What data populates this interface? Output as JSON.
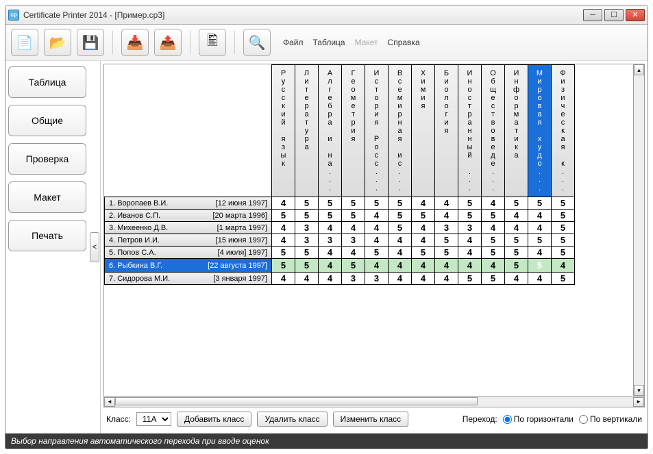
{
  "window": {
    "title": "Certificate Printer 2014 - [Пример.cp3]"
  },
  "toolbar_icons": {
    "new": "📄",
    "open": "📂",
    "save": "💾",
    "import": "📥",
    "export": "📤",
    "preview": "🖺",
    "search": "🔍"
  },
  "menu": {
    "file": "Файл",
    "table": "Таблица",
    "layout": "Макет",
    "help": "Справка"
  },
  "sidebar": {
    "items": [
      "Таблица",
      "Общие",
      "Проверка",
      "Макет",
      "Печать"
    ],
    "toggle": "<"
  },
  "columns": [
    "Русский язык",
    "Литература",
    "Алгебра и на...",
    "Геометрия",
    "История Росс...",
    "Всемирная ис...",
    "Химия",
    "Биология",
    "Иностранный ...",
    "Обществоведе...",
    "Информатика",
    "Мировая худо...",
    "Физическая к..."
  ],
  "highlight_col": 11,
  "rows": [
    {
      "n": "1. Воропаев В.И.",
      "d": "[12 июня 1997]",
      "v": [
        4,
        5,
        5,
        5,
        5,
        5,
        4,
        4,
        5,
        4,
        5,
        5,
        5
      ]
    },
    {
      "n": "2. Иванов С.П.",
      "d": "[20 марта 1996]",
      "v": [
        5,
        5,
        5,
        5,
        4,
        5,
        5,
        4,
        5,
        5,
        4,
        4,
        5
      ]
    },
    {
      "n": "3. Михеенко Д.В.",
      "d": "[1 марта 1997]",
      "v": [
        4,
        3,
        4,
        4,
        4,
        5,
        4,
        3,
        3,
        4,
        4,
        4,
        5
      ]
    },
    {
      "n": "4. Петров И.И.",
      "d": "[15 июня 1997]",
      "v": [
        4,
        3,
        3,
        3,
        4,
        4,
        4,
        5,
        4,
        5,
        5,
        5,
        5
      ]
    },
    {
      "n": "5. Попов С.А.",
      "d": "[4 июля] 1997]",
      "v": [
        5,
        5,
        4,
        4,
        5,
        4,
        5,
        5,
        4,
        5,
        5,
        4,
        5
      ]
    },
    {
      "n": "6. Рыбкина В.Г.",
      "d": "[22 августа 1997]",
      "v": [
        5,
        5,
        4,
        5,
        4,
        4,
        4,
        4,
        4,
        4,
        5,
        5,
        4
      ],
      "sel": true
    },
    {
      "n": "7. Сидорова М.И.",
      "d": "[3 января 1997]",
      "v": [
        4,
        4,
        4,
        3,
        3,
        4,
        4,
        4,
        5,
        5,
        4,
        4,
        5
      ]
    }
  ],
  "bottom": {
    "class_label": "Класс:",
    "class_value": "11А",
    "add": "Добавить класс",
    "del": "Удалить класс",
    "edit": "Изменить класс",
    "nav_label": "Переход:",
    "horiz": "По горизонтали",
    "vert": "По вертикали"
  },
  "status": "Выбор направления автоматического перехода при вводе оценок"
}
